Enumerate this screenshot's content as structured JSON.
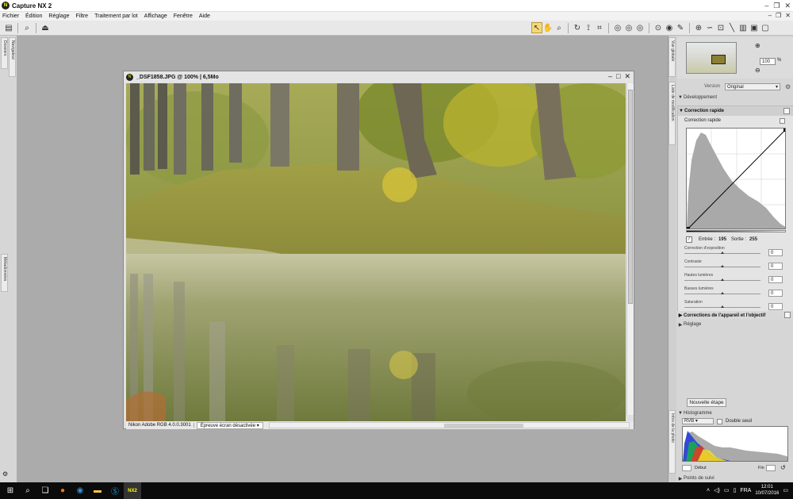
{
  "app": {
    "title": "Capture NX 2",
    "logo_text": "N"
  },
  "menu": {
    "items": [
      "Fichier",
      "Édition",
      "Réglage",
      "Filtre",
      "Traitement par lot",
      "Affichage",
      "Fenêtre",
      "Aide"
    ]
  },
  "left_tabs": {
    "folders": "Dossiers",
    "browser": "Navigateur",
    "metadata": "Métadonnées"
  },
  "document": {
    "title": "_DSF1858.JPG @ 100% | 6,5Mo",
    "profile": "Nikon Adobe RGB 4.0.0.3001",
    "proof": "Épreuve écran désactivée"
  },
  "navigator": {
    "tab": "Vue globale",
    "zoom": "100",
    "zoom_unit": "%"
  },
  "edit_list": {
    "tab": "Liste de modification",
    "version_label": "Version",
    "version_value": "Original",
    "section_dev": "Développement",
    "quick_fix": "Correction rapide",
    "quick_fix_sub": "Correction rapide",
    "input_label": "Entrée :",
    "input_value": "195",
    "output_label": "Sortie :",
    "output_value": "255",
    "sliders": [
      {
        "label": "Correction d'exposition",
        "value": "0",
        "pos": 0.5
      },
      {
        "label": "Contraste",
        "value": "0",
        "pos": 0.5
      },
      {
        "label": "Hautes lumières",
        "value": "0",
        "pos": 0.5
      },
      {
        "label": "Basses lumières",
        "value": "0",
        "pos": 0.5
      },
      {
        "label": "Saturation",
        "value": "0",
        "pos": 0.5
      }
    ],
    "lens_corrections": "Corrections de l'appareil et l'objectif",
    "settings": "Réglage",
    "new_step": "Nouvelle étape"
  },
  "histogram": {
    "tab": "Infos de la photo",
    "title": "Histogramme",
    "channel": "RVB",
    "double_threshold": "Double seuil",
    "start_label": "Début",
    "end_label": "Fin",
    "points": "Points de suivi"
  },
  "taskbar": {
    "language": "FRA",
    "time": "12:01",
    "date": "10/07/2016",
    "app_label": "NX2"
  }
}
